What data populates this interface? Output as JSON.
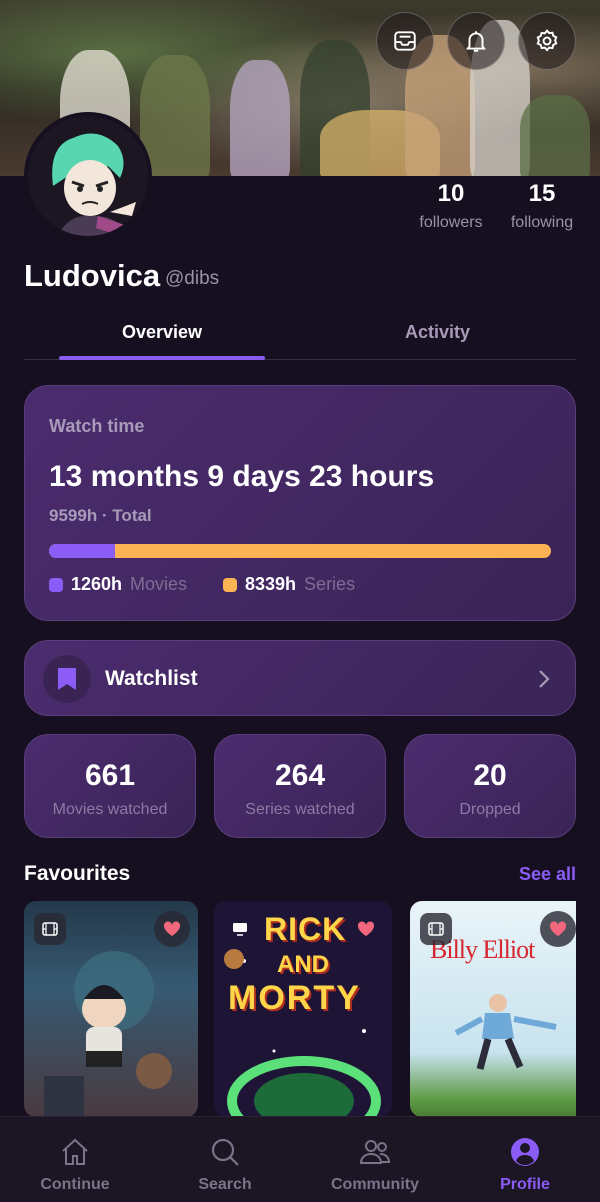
{
  "profile": {
    "name": "Ludovica",
    "handle": "@dibs",
    "followers_count": "10",
    "followers_label": "followers",
    "following_count": "15",
    "following_label": "following"
  },
  "top_icons": [
    "inbox-icon",
    "bell-icon",
    "gear-icon"
  ],
  "tabs": [
    {
      "label": "Overview",
      "active": true
    },
    {
      "label": "Activity",
      "active": false
    }
  ],
  "watch_time": {
    "title": "Watch time",
    "duration": "13 months 9 days 23 hours",
    "total": "9599h · Total",
    "movies_fraction": 0.131,
    "movies_hours": "1260h",
    "movies_label": "Movies",
    "series_hours": "8339h",
    "series_label": "Series",
    "colors": {
      "movies": "#8b5cf6",
      "series": "#fbb354"
    }
  },
  "watchlist": {
    "label": "Watchlist"
  },
  "stats": [
    {
      "value": "661",
      "label": "Movies watched"
    },
    {
      "value": "264",
      "label": "Series watched"
    },
    {
      "value": "20",
      "label": "Dropped"
    }
  ],
  "favourites": {
    "title": "Favourites",
    "see_all": "See all",
    "items": [
      {
        "type_icon": "film-icon"
      },
      {
        "type_icon": "tv-icon",
        "logo_line1": "RICK",
        "logo_line2": "AND",
        "logo_line3": "MORTY"
      },
      {
        "type_icon": "film-icon",
        "logo": "Billy Elliot"
      }
    ]
  },
  "nav": [
    {
      "label": "Continue",
      "icon": "home-icon",
      "active": false
    },
    {
      "label": "Search",
      "icon": "search-icon",
      "active": false
    },
    {
      "label": "Community",
      "icon": "people-icon",
      "active": false
    },
    {
      "label": "Profile",
      "icon": "profile-icon",
      "active": true
    }
  ],
  "accent": "#8b5cf6"
}
